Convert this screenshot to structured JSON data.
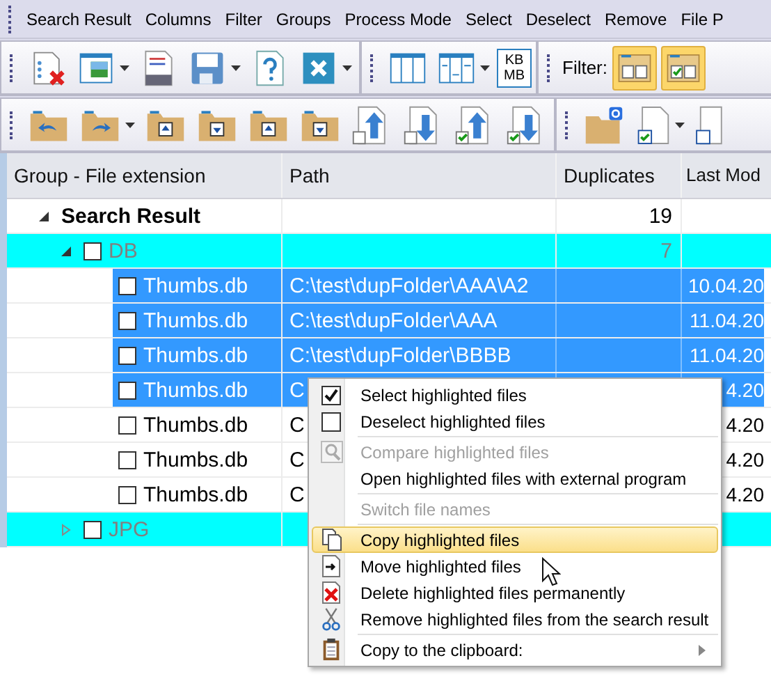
{
  "menubar": [
    {
      "label": "Search Result"
    },
    {
      "label": "Columns"
    },
    {
      "label": "Filter"
    },
    {
      "label": "Groups"
    },
    {
      "label": "Process Mode"
    },
    {
      "label": "Select"
    },
    {
      "label": "Deselect"
    },
    {
      "label": "Remove"
    },
    {
      "label": "File P"
    }
  ],
  "toolbar": {
    "size_units": [
      "KB",
      "MB"
    ],
    "filter_label": "Filter:",
    "filter_buttons": [
      {
        "selected": true
      },
      {
        "selected": true
      }
    ]
  },
  "table": {
    "columns": [
      "Group - File extension",
      "Path",
      "Duplicates",
      "Last Mod"
    ],
    "rows": [
      {
        "name": "Search Result",
        "duplicates": "19",
        "expanded": true,
        "children": [
          {
            "name": "DB",
            "checked": false,
            "duplicates": "7",
            "expanded": true,
            "children": [
              {
                "name": "Thumbs.db",
                "path": "C:\\test\\dupFolder\\AAA\\A2",
                "modified": "10.04.20",
                "selected": true,
                "checked": false
              },
              {
                "name": "Thumbs.db",
                "path": "C:\\test\\dupFolder\\AAA",
                "modified": "11.04.20",
                "selected": true,
                "checked": false
              },
              {
                "name": "Thumbs.db",
                "path": "C:\\test\\dupFolder\\BBBB",
                "modified": "11.04.20",
                "selected": true,
                "checked": false
              },
              {
                "name": "Thumbs.db",
                "path": "C",
                "modified": "4.20",
                "selected": true,
                "checked": false
              },
              {
                "name": "Thumbs.db",
                "path": "C",
                "modified": "4.20",
                "selected": false,
                "checked": false
              },
              {
                "name": "Thumbs.db",
                "path": "C",
                "modified": "4.20",
                "selected": false,
                "checked": false
              },
              {
                "name": "Thumbs.db",
                "path": "C",
                "modified": "4.20",
                "selected": false,
                "checked": false
              }
            ]
          },
          {
            "name": "JPG",
            "checked": false,
            "expanded": false
          }
        ]
      }
    ]
  },
  "context_menu": [
    {
      "kind": "item",
      "label": "Select highlighted files",
      "disabled": false,
      "selected": false
    },
    {
      "kind": "item",
      "label": "Deselect highlighted files",
      "disabled": false,
      "selected": false
    },
    {
      "kind": "separator"
    },
    {
      "kind": "item",
      "label": "Compare highlighted files",
      "disabled": true,
      "selected": false
    },
    {
      "kind": "item",
      "label": "Open highlighted files with external program",
      "disabled": false,
      "selected": false
    },
    {
      "kind": "separator"
    },
    {
      "kind": "item",
      "label": "Switch file names",
      "disabled": true,
      "selected": false
    },
    {
      "kind": "separator"
    },
    {
      "kind": "item",
      "label": "Copy highlighted files",
      "disabled": false,
      "selected": true
    },
    {
      "kind": "item",
      "label": "Move highlighted files",
      "disabled": false,
      "selected": false
    },
    {
      "kind": "item",
      "label": "Delete highlighted files permanently",
      "disabled": false,
      "selected": false
    },
    {
      "kind": "item",
      "label": "Remove highlighted files from the search result",
      "disabled": false,
      "selected": false
    },
    {
      "kind": "separator"
    },
    {
      "kind": "item",
      "label": "Copy to the clipboard:",
      "disabled": false,
      "selected": false,
      "submenu": true
    }
  ]
}
